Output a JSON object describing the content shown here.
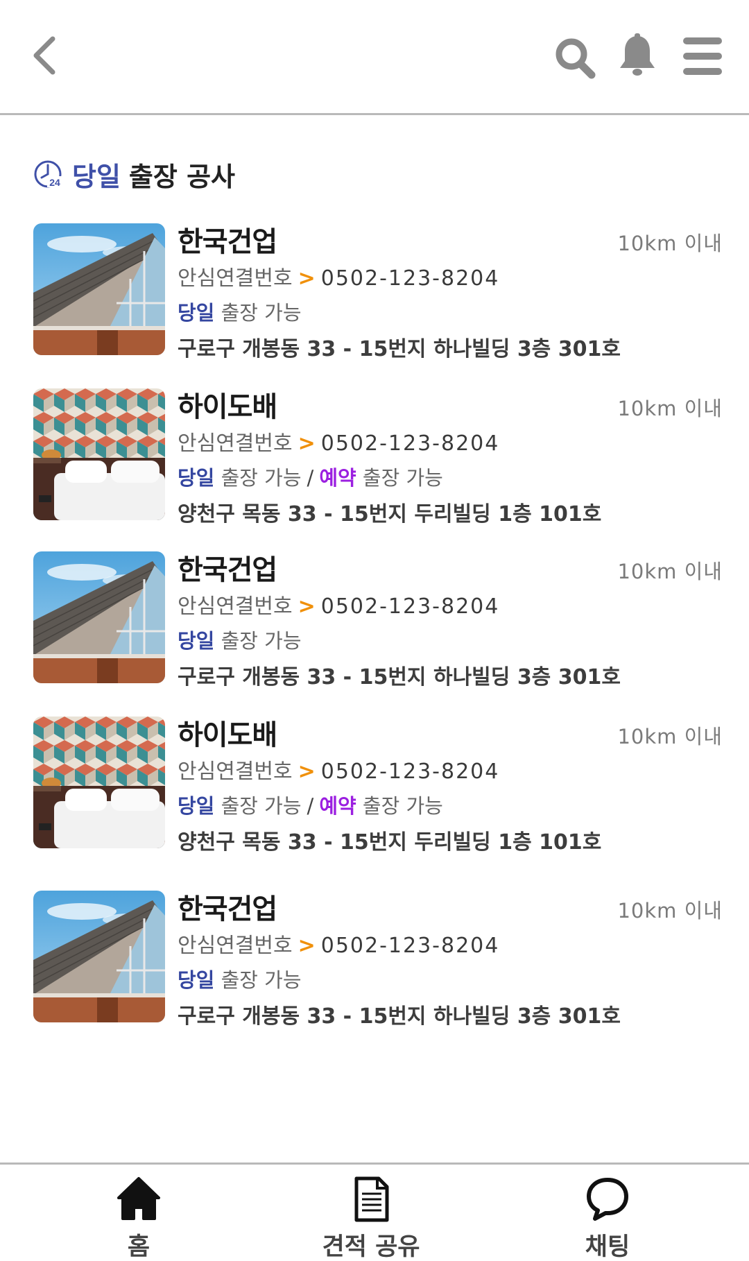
{
  "header": {
    "back_icon": "chevron-left-icon",
    "search_icon": "search-icon",
    "bell_icon": "bell-icon",
    "menu_icon": "hamburger-menu-icon"
  },
  "section": {
    "icon": "clock-24-icon",
    "accent_label": "당일",
    "rest_label": "출장 공사"
  },
  "colors": {
    "accent": "#3f50a8",
    "same_day": "#3446a0",
    "reserve": "#9b1fe0",
    "arrow": "#f0900a"
  },
  "items": [
    {
      "name": "한국건업",
      "distance": "10km 이내",
      "phone_label": "안심연결번호",
      "phone_arrow": ">",
      "phone": "0502-123-8204",
      "same_day": "당일",
      "same_day_text": "출장 가능",
      "separator": "",
      "reserve": "",
      "reserve_text": "",
      "address": "구로구 개봉동 33 - 15번지 하나빌딩 3층 301호",
      "thumb": "house-roof"
    },
    {
      "name": "하이도배",
      "distance": "10km 이내",
      "phone_label": "안심연결번호",
      "phone_arrow": ">",
      "phone": "0502-123-8204",
      "same_day": "당일",
      "same_day_text": "출장 가능",
      "separator": "/",
      "reserve": "예약",
      "reserve_text": "출장 가능",
      "address": "양천구 목동 33 - 15번지 두리빌딩 1층 101호",
      "thumb": "wallpaper-bedroom"
    },
    {
      "name": "한국건업",
      "distance": "10km 이내",
      "phone_label": "안심연결번호",
      "phone_arrow": ">",
      "phone": "0502-123-8204",
      "same_day": "당일",
      "same_day_text": "출장 가능",
      "separator": "",
      "reserve": "",
      "reserve_text": "",
      "address": "구로구 개봉동 33 - 15번지 하나빌딩 3층 301호",
      "thumb": "house-roof"
    },
    {
      "name": "하이도배",
      "distance": "10km 이내",
      "phone_label": "안심연결번호",
      "phone_arrow": ">",
      "phone": "0502-123-8204",
      "same_day": "당일",
      "same_day_text": "출장 가능",
      "separator": "/",
      "reserve": "예약",
      "reserve_text": "출장 가능",
      "address": "양천구 목동 33 - 15번지 두리빌딩 1층 101호",
      "thumb": "wallpaper-bedroom"
    },
    {
      "name": "한국건업",
      "distance": "10km 이내",
      "phone_label": "안심연결번호",
      "phone_arrow": ">",
      "phone": "0502-123-8204",
      "same_day": "당일",
      "same_day_text": "출장 가능",
      "separator": "",
      "reserve": "",
      "reserve_text": "",
      "address": "구로구 개봉동 33 - 15번지 하나빌딩 3층 301호",
      "thumb": "house-roof"
    }
  ],
  "bottom_nav": {
    "home": {
      "label": "홈",
      "icon": "home-icon"
    },
    "estimate": {
      "label": "견적 공유",
      "icon": "document-icon"
    },
    "chat": {
      "label": "채팅",
      "icon": "chat-bubble-icon"
    }
  }
}
